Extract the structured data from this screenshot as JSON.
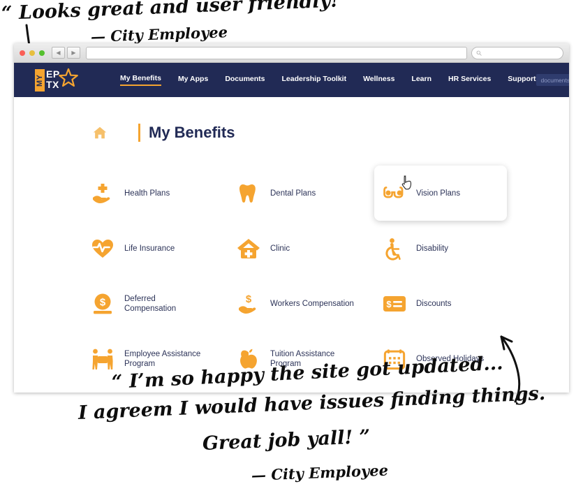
{
  "quotes": {
    "top": {
      "line1": "“ Looks great and user friendly! ”",
      "line2": "— City Employee"
    },
    "bottom": {
      "line1": "“ I’m so happy the site got updated...",
      "line2": "I agreem I would have issues finding things.",
      "line3": "Great job yall! ”",
      "line4": "— City Employee"
    }
  },
  "browser": {
    "back_glyph": "◀",
    "forward_glyph": "▶",
    "address_value": "",
    "chrome_search_placeholder": "",
    "search_icon": "search-icon"
  },
  "site_nav": {
    "logo": {
      "my": "MY",
      "ep": "EP",
      "tx": "TX"
    },
    "links": [
      {
        "label": "My Benefits",
        "active": true
      },
      {
        "label": "My Apps",
        "active": false
      },
      {
        "label": "Documents",
        "active": false
      },
      {
        "label": "Leadership Toolkit",
        "active": false
      },
      {
        "label": "Wellness",
        "active": false
      },
      {
        "label": "Learn",
        "active": false
      },
      {
        "label": "HR Services",
        "active": false
      },
      {
        "label": "Support",
        "active": false
      }
    ],
    "search": {
      "placeholder": "documents",
      "value": "documents",
      "icon": "search-icon"
    }
  },
  "page": {
    "home_icon": "home-icon",
    "title": "My Benefits"
  },
  "tiles": [
    {
      "label_line1": "Health Plans",
      "label_line2": "",
      "icon": "hand-plus-icon",
      "hover": false
    },
    {
      "label_line1": "Dental Plans",
      "label_line2": "",
      "icon": "tooth-icon",
      "hover": false
    },
    {
      "label_line1": "Vision Plans",
      "label_line2": "",
      "icon": "glasses-icon",
      "hover": true
    },
    {
      "label_line1": "Life Insurance",
      "label_line2": "",
      "icon": "heart-pulse-icon",
      "hover": false
    },
    {
      "label_line1": "Clinic",
      "label_line2": "",
      "icon": "clinic-house-icon",
      "hover": false
    },
    {
      "label_line1": "Disability",
      "label_line2": "",
      "icon": "wheelchair-icon",
      "hover": false
    },
    {
      "label_line1": "Deferred",
      "label_line2": "Compensation",
      "icon": "coin-stack-icon",
      "hover": false
    },
    {
      "label_line1": "Workers Compensation",
      "label_line2": "",
      "icon": "hand-dollar-icon",
      "hover": false
    },
    {
      "label_line1": "Discounts",
      "label_line2": "",
      "icon": "coupon-icon",
      "hover": false
    },
    {
      "label_line1": "Employee Assistance",
      "label_line2": "Program",
      "icon": "two-people-icon",
      "hover": false
    },
    {
      "label_line1": "Tuition Assistance",
      "label_line2": "Program",
      "icon": "apple-icon",
      "hover": false
    },
    {
      "label_line1": "Observed Holidays",
      "label_line2": "",
      "icon": "calendar-icon",
      "hover": false
    }
  ],
  "colors": {
    "navy": "#212a55",
    "orange": "#f5a430",
    "text": "#2c3358",
    "page_bg": "#ffffff"
  }
}
